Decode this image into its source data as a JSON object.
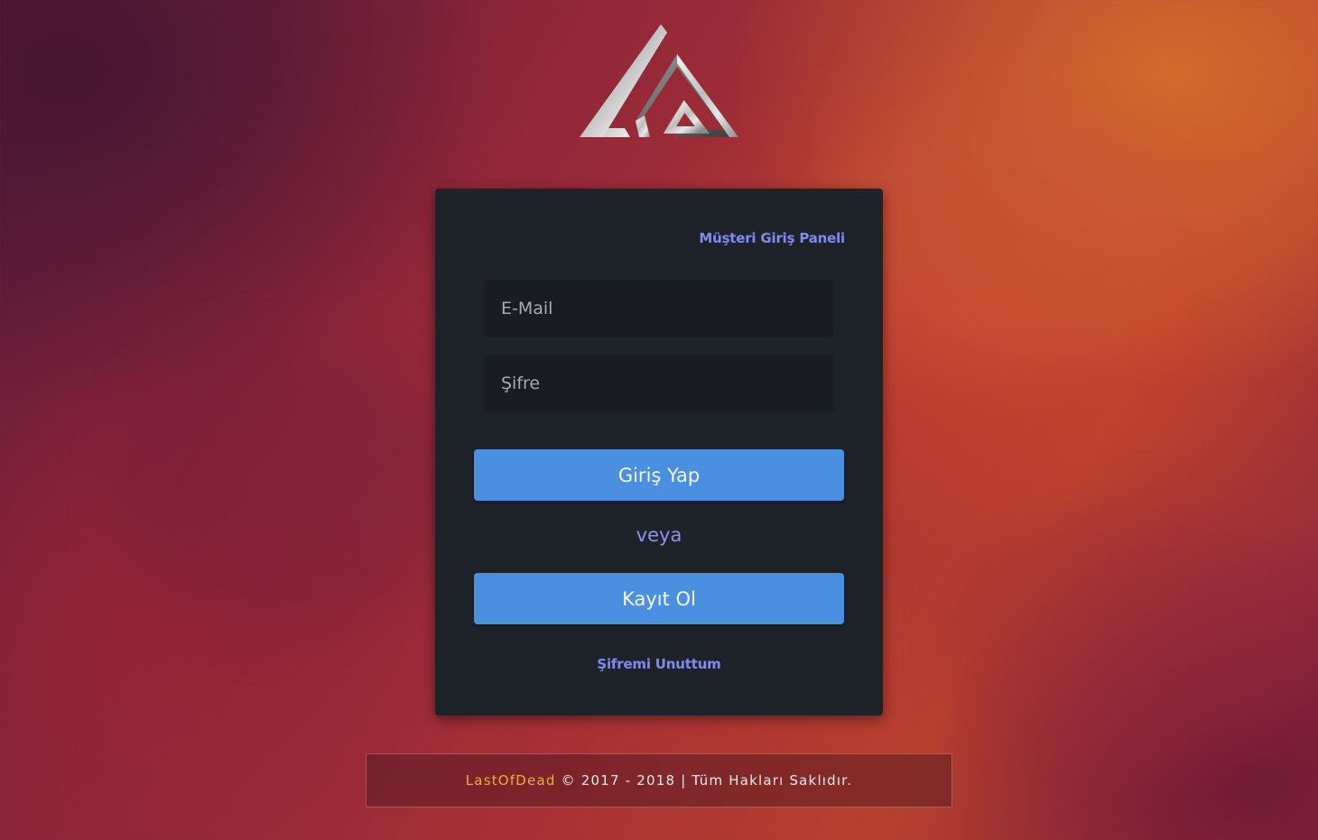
{
  "panel": {
    "title": "Müşteri Giriş Paneli",
    "email_placeholder": "E-Mail",
    "password_placeholder": "Şifre",
    "login_label": "Giriş Yap",
    "or_label": "veya",
    "register_label": "Kayıt Ol",
    "forgot_label": "Şifremi Unuttum"
  },
  "footer": {
    "brand": "LastOfDead",
    "copyright": "© 2017 - 2018 | Tüm Hakları Saklıdır."
  },
  "colors": {
    "accent_blue": "#4a8fe0",
    "link_purple": "#7e8cf0",
    "brand_gold": "#e3b236",
    "panel_bg": "#1e2329"
  },
  "icons": {
    "logo": "triangle-logo-icon"
  }
}
